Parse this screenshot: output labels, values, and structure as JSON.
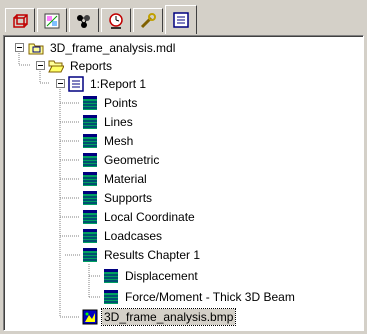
{
  "tabs": [
    {
      "id": "model",
      "icon": "model-frame-icon",
      "active": false
    },
    {
      "id": "graphics",
      "icon": "graphics-canvas-icon",
      "active": false
    },
    {
      "id": "analysis",
      "icon": "node-network-icon",
      "active": false
    },
    {
      "id": "results",
      "icon": "clock-icon",
      "active": false
    },
    {
      "id": "tools",
      "icon": "wrench-icon",
      "active": false
    },
    {
      "id": "reports",
      "icon": "report-list-icon",
      "active": true
    }
  ],
  "tree": {
    "root": {
      "label": "3D_frame_analysis.mdl",
      "icon": "model-folder-icon",
      "expanded": true
    },
    "reports": {
      "label": "Reports",
      "icon": "open-folder-icon",
      "expanded": true
    },
    "report1": {
      "label": "1:Report 1",
      "icon": "report-document-icon",
      "expanded": true
    },
    "chapters": [
      {
        "label": "Points",
        "icon": "chapter-table-icon"
      },
      {
        "label": "Lines",
        "icon": "chapter-table-icon"
      },
      {
        "label": "Mesh",
        "icon": "chapter-table-icon"
      },
      {
        "label": "Geometric",
        "icon": "chapter-table-icon"
      },
      {
        "label": "Material",
        "icon": "chapter-table-icon"
      },
      {
        "label": "Supports",
        "icon": "chapter-table-icon"
      },
      {
        "label": "Local Coordinate",
        "icon": "chapter-table-icon"
      },
      {
        "label": "Loadcases",
        "icon": "chapter-table-icon"
      }
    ],
    "results_chapter": {
      "label": "Results Chapter 1",
      "icon": "chapter-table-icon",
      "expanded": true
    },
    "results_items": [
      {
        "label": "Displacement",
        "icon": "results-table-icon"
      },
      {
        "label": "Force/Moment - Thick 3D Beam",
        "icon": "results-table-icon"
      }
    ],
    "image_item": {
      "label": "3D_frame_analysis.bmp",
      "icon": "bitmap-image-icon",
      "selected": true
    }
  },
  "colors": {
    "chapter_green": "#00a060",
    "chapter_navy": "#000080",
    "folder_yellow": "#ffff99",
    "selection_bg": "#d4d0c8"
  }
}
